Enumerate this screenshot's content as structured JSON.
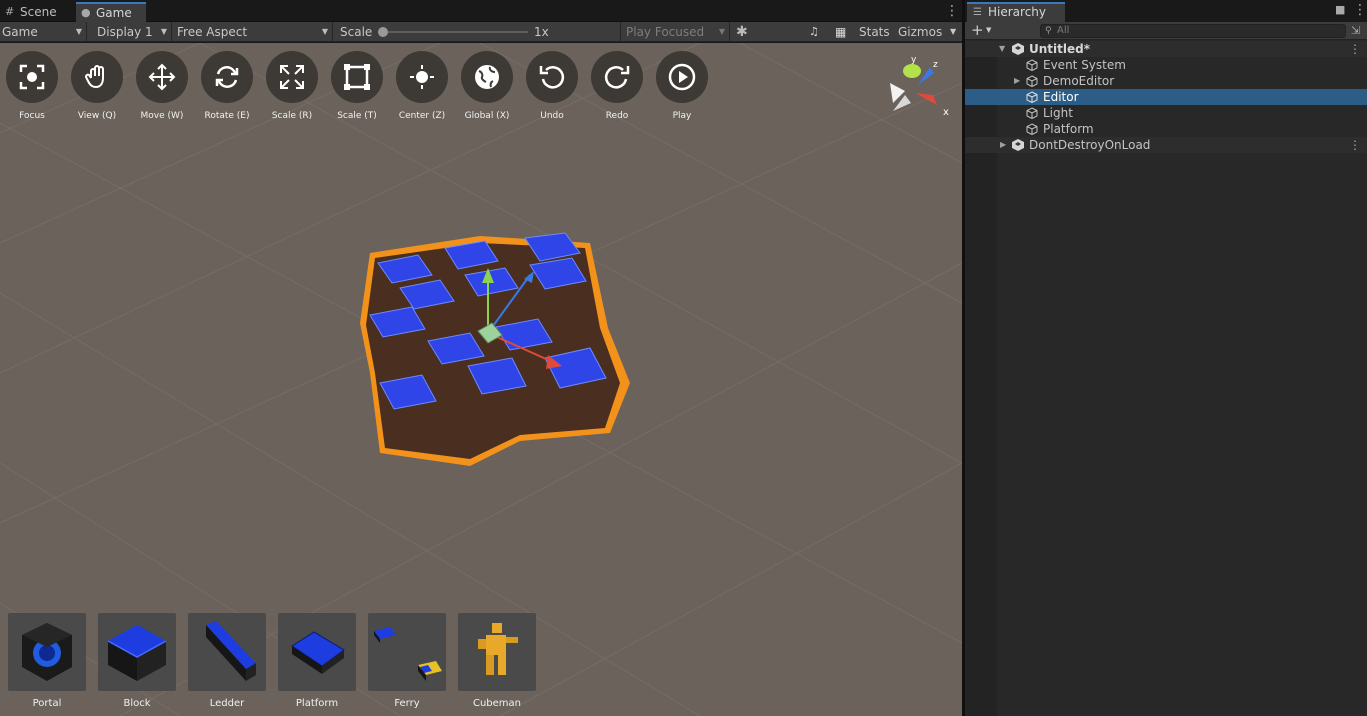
{
  "tabs": {
    "scene_label": "Scene",
    "game_label": "Game"
  },
  "game_toolbar": {
    "game_dropdown": "Game",
    "display_dropdown": "Display 1",
    "aspect_dropdown": "Free Aspect",
    "scale_label": "Scale",
    "scale_value": "1x",
    "play_focused": "Play Focused",
    "stats": "Stats",
    "gizmos": "Gizmos"
  },
  "tools": [
    {
      "label": "Focus",
      "icon": "focus-icon"
    },
    {
      "label": "View (Q)",
      "icon": "hand-icon"
    },
    {
      "label": "Move (W)",
      "icon": "move-icon"
    },
    {
      "label": "Rotate (E)",
      "icon": "rotate-icon"
    },
    {
      "label": "Scale (R)",
      "icon": "scale-icon"
    },
    {
      "label": "Scale (T)",
      "icon": "rect-scale-icon"
    },
    {
      "label": "Center (Z)",
      "icon": "center-icon"
    },
    {
      "label": "Global (X)",
      "icon": "globe-icon"
    },
    {
      "label": "Undo",
      "icon": "undo-icon"
    },
    {
      "label": "Redo",
      "icon": "redo-icon"
    },
    {
      "label": "Play",
      "icon": "play-icon"
    }
  ],
  "gizmo_axes": {
    "y": "y",
    "z": "z",
    "x": "x"
  },
  "prefabs": [
    {
      "label": "Portal"
    },
    {
      "label": "Block"
    },
    {
      "label": "Ledder"
    },
    {
      "label": "Platform"
    },
    {
      "label": "Ferry"
    },
    {
      "label": "Cubeman"
    }
  ],
  "hierarchy": {
    "tab_label": "Hierarchy",
    "search_placeholder": "All",
    "rows": [
      {
        "label": "Untitled*",
        "type": "scene",
        "expanded": true
      },
      {
        "label": "Event System",
        "type": "object"
      },
      {
        "label": "DemoEditor",
        "type": "object",
        "collapsed": true
      },
      {
        "label": "Editor",
        "type": "object",
        "selected": true
      },
      {
        "label": "Light",
        "type": "object"
      },
      {
        "label": "Platform",
        "type": "object"
      },
      {
        "label": "DontDestroyOnLoad",
        "type": "scene",
        "collapsed": true
      }
    ]
  },
  "colors": {
    "accent": "#3a79bb",
    "selection": "#2c5d87",
    "viewport_bg": "#6a625b",
    "tile_blue": "#2f45e8",
    "outline_orange": "#f3921b"
  }
}
